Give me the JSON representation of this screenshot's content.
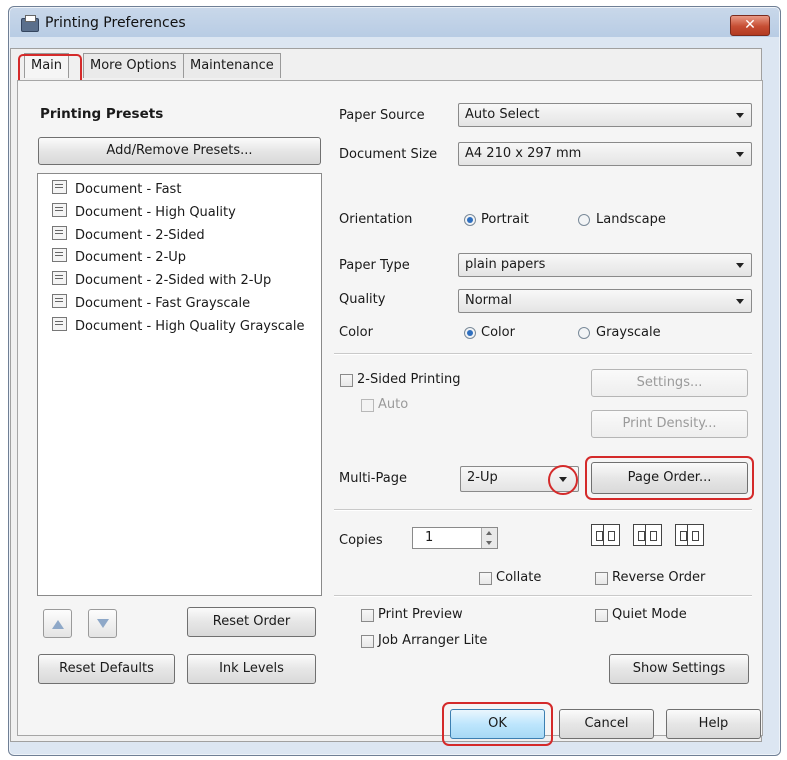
{
  "window": {
    "title": "Printing Preferences",
    "close_glyph": "✕"
  },
  "tabs": [
    {
      "label": "Main",
      "active": true
    },
    {
      "label": "More Options",
      "active": false
    },
    {
      "label": "Maintenance",
      "active": false
    }
  ],
  "presets": {
    "heading": "Printing Presets",
    "add_remove_label": "Add/Remove Presets...",
    "items": [
      {
        "label": "Document - Fast",
        "icon": "document-fast-icon"
      },
      {
        "label": "Document - High Quality",
        "icon": "document-high-quality-icon"
      },
      {
        "label": "Document - 2-Sided",
        "icon": "document-2-sided-icon"
      },
      {
        "label": "Document - 2-Up",
        "icon": "document-2-up-icon"
      },
      {
        "label": "Document - 2-Sided with 2-Up",
        "icon": "document-2-sided-2-up-icon"
      },
      {
        "label": "Document - Fast Grayscale",
        "icon": "document-fast-grayscale-icon"
      },
      {
        "label": "Document - High Quality Grayscale",
        "icon": "document-hq-grayscale-icon"
      }
    ],
    "reset_order_label": "Reset Order",
    "reset_defaults_label": "Reset Defaults",
    "ink_levels_label": "Ink Levels"
  },
  "settings": {
    "paper_source": {
      "label": "Paper Source",
      "value": "Auto Select"
    },
    "document_size": {
      "label": "Document Size",
      "value": "A4 210 x 297 mm"
    },
    "orientation": {
      "label": "Orientation",
      "options": [
        "Portrait",
        "Landscape"
      ],
      "selected": "Portrait"
    },
    "paper_type": {
      "label": "Paper Type",
      "value": "plain papers"
    },
    "quality": {
      "label": "Quality",
      "value": "Normal"
    },
    "color": {
      "label": "Color",
      "options": [
        "Color",
        "Grayscale"
      ],
      "selected": "Color"
    },
    "two_sided": {
      "label": "2-Sided Printing",
      "checked": false
    },
    "auto": {
      "label": "Auto",
      "checked": false,
      "enabled": false
    },
    "settings_label": "Settings...",
    "print_density_label": "Print Density...",
    "multi_page": {
      "label": "Multi-Page",
      "value": "2-Up"
    },
    "page_order_label": "Page Order...",
    "copies": {
      "label": "Copies",
      "value": "1"
    },
    "collate": {
      "label": "Collate",
      "checked": false
    },
    "reverse_order": {
      "label": "Reverse Order",
      "checked": false
    },
    "print_preview": {
      "label": "Print Preview",
      "checked": false
    },
    "quiet_mode": {
      "label": "Quiet Mode",
      "checked": false
    },
    "job_arranger": {
      "label": "Job Arranger Lite",
      "checked": false
    },
    "show_settings_label": "Show Settings"
  },
  "footer": {
    "ok_label": "OK",
    "cancel_label": "Cancel",
    "help_label": "Help"
  },
  "colors": {
    "highlight": "#d42a2a",
    "radio_selected": "#2f6fbf"
  }
}
